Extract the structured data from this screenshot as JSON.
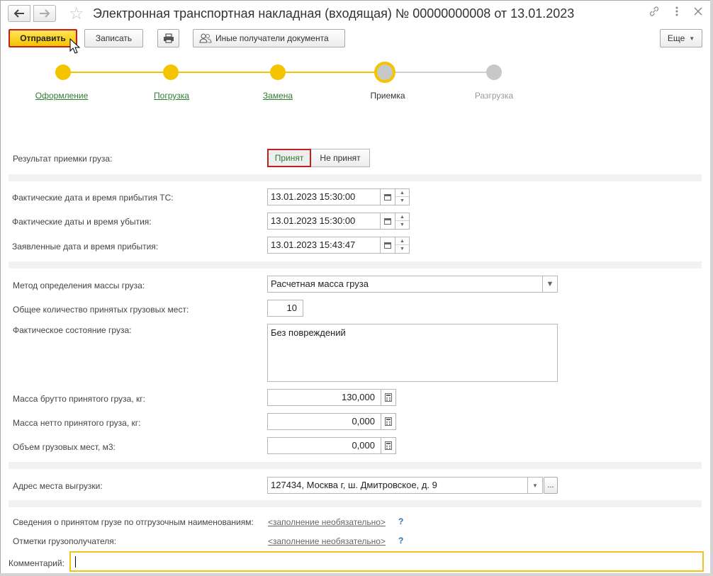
{
  "window": {
    "title": "Электронная транспортная накладная (входящая) № 00000000008 от 13.01.2023"
  },
  "icons": {
    "back": "arrow-left-icon",
    "forward": "arrow-right-icon",
    "favorite": "star-icon",
    "link": "link-icon",
    "menu": "kebab-menu-icon",
    "close": "close-icon",
    "print": "printer-icon",
    "recipients": "users-icon",
    "calendar": "calendar-icon",
    "calculator": "calculator-icon",
    "dropdown": "chevron-down-icon"
  },
  "toolbar": {
    "send_label": "Отправить",
    "save_label": "Записать",
    "recipients_label": "Иные получатели документа",
    "more_label": "Еще"
  },
  "steps": [
    {
      "label": "Оформление",
      "state": "done"
    },
    {
      "label": "Погрузка",
      "state": "done"
    },
    {
      "label": "Замена",
      "state": "done"
    },
    {
      "label": "Приемка",
      "state": "current"
    },
    {
      "label": "Разгрузка",
      "state": "pending"
    }
  ],
  "acceptance": {
    "label": "Результат приемки груза:",
    "accepted": "Принят",
    "not_accepted": "Не принят",
    "selected": "Принят"
  },
  "dates": {
    "arrival_label": "Фактические дата и время прибытия ТС:",
    "arrival_value": "13.01.2023 15:30:00",
    "departure_label": "Фактические даты и время убытия:",
    "departure_value": "13.01.2023 15:30:00",
    "declared_label": "Заявленные дата и время прибытия:",
    "declared_value": "13.01.2023 15:43:47"
  },
  "cargo": {
    "method_label": "Метод определения массы груза:",
    "method_value": "Расчетная масса груза",
    "places_label": "Общее количество принятых грузовых мест:",
    "places_value": "10",
    "state_label": "Фактическое состояние груза:",
    "state_value": "Без повреждений",
    "gross_label": "Масса брутто принятого груза, кг:",
    "gross_value": "130,000",
    "net_label": "Масса нетто принятого груза, кг:",
    "net_value": "0,000",
    "volume_label": "Объем грузовых мест, м3:",
    "volume_value": "0,000"
  },
  "address": {
    "label": "Адрес места выгрузки:",
    "value": "127434, Москва г, ш. Дмитровское, д. 9",
    "more": "..."
  },
  "optional": {
    "items_label": "Сведения о принятом грузе по отгрузочным наименованиям:",
    "items_link": "<заполнение необязательно>",
    "marks_label": "Отметки грузополучателя:",
    "marks_link": "<заполнение необязательно>",
    "help": "?"
  },
  "comment": {
    "label": "Комментарий:",
    "value": ""
  },
  "colors": {
    "accent_yellow": "#f5c400",
    "done_link": "#2f7d32",
    "highlight_red": "#c21f1f",
    "focus_border": "#f0c419"
  }
}
